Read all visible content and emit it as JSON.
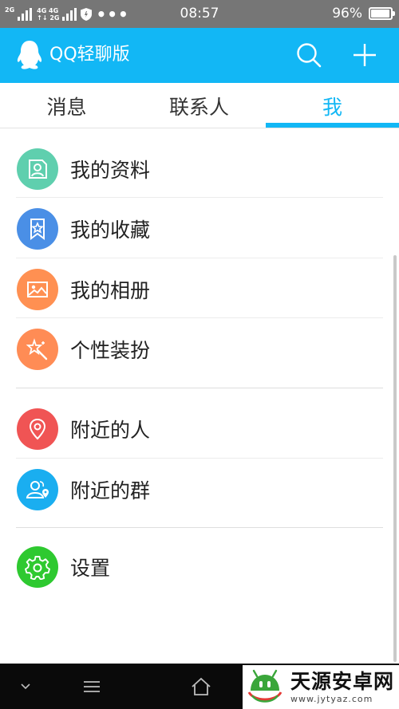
{
  "status_bar": {
    "network_label_1": "2G",
    "network_label_2_top": "4G 4G",
    "network_label_2_bottom": "↑↓ 2G",
    "more": "•••",
    "time": "08:57",
    "battery_percent": "96%",
    "battery_level": 0.96
  },
  "header": {
    "title": "QQ轻聊版"
  },
  "tabs": [
    {
      "label": "消息"
    },
    {
      "label": "联系人"
    },
    {
      "label": "我"
    }
  ],
  "menu": {
    "items": [
      {
        "label": "我的资料",
        "color": "#5fcfae"
      },
      {
        "label": "我的收藏",
        "color": "#4a8fe6"
      },
      {
        "label": "我的相册",
        "color": "#ff9052"
      },
      {
        "label": "个性装扮",
        "color": "#ff8c55"
      },
      {
        "label": "附近的人",
        "color": "#f05454"
      },
      {
        "label": "附近的群",
        "color": "#1aaef0"
      },
      {
        "label": "设置",
        "color": "#2ec930"
      }
    ]
  },
  "watermark": {
    "title": "天源安卓网",
    "url": "www.jytyaz.com"
  },
  "colors": {
    "brand": "#12b7f5",
    "status_bar": "#767676"
  }
}
